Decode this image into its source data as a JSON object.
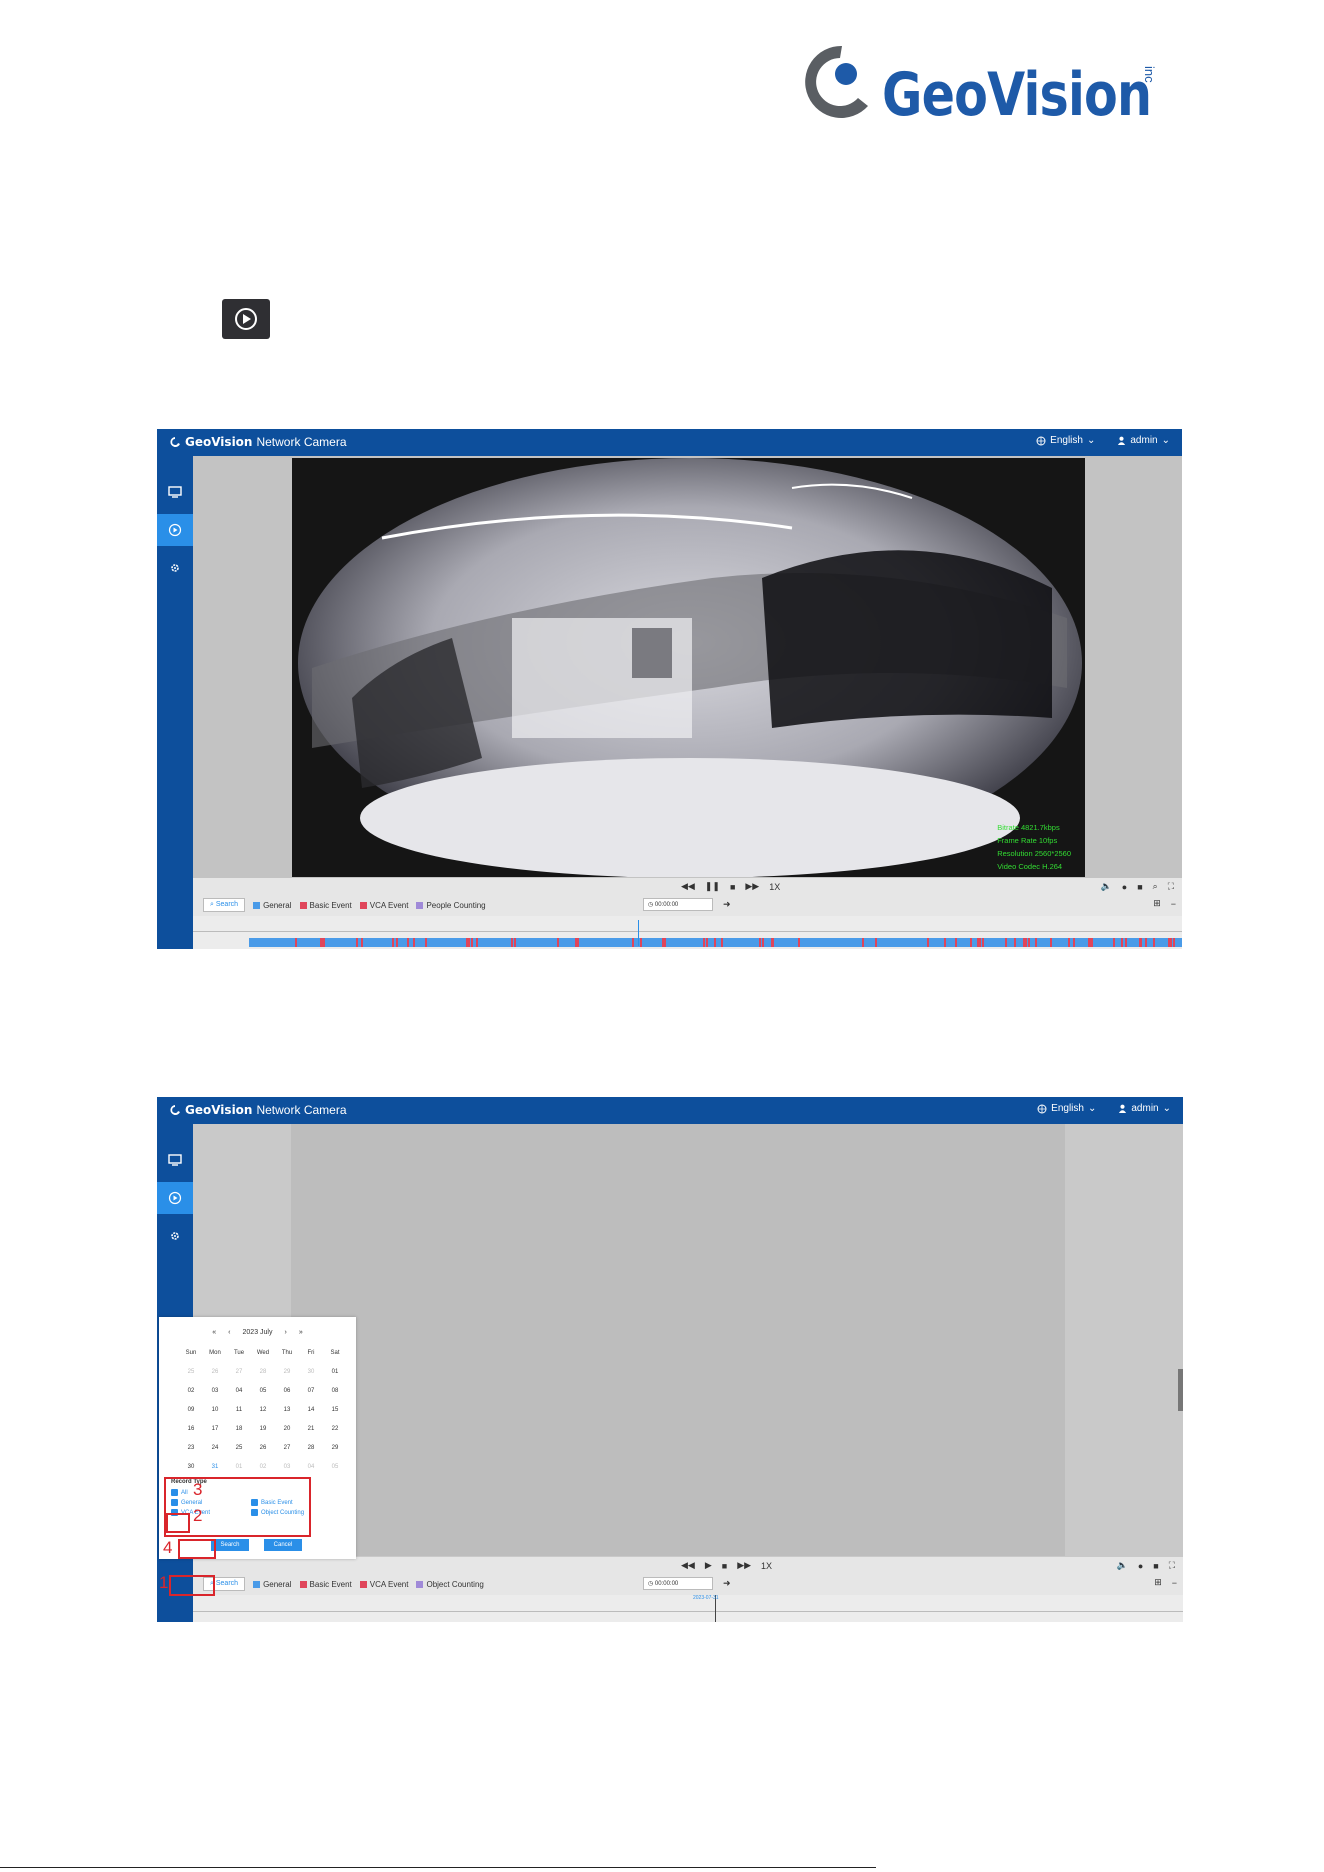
{
  "logo": {
    "word": "GeoVision",
    "inc": "inc"
  },
  "shot1": {
    "app_name": "Network Camera",
    "brand": "GeoVision",
    "language": "English",
    "user": "admin",
    "osd": {
      "bitrate": "Bitrate 4821.7kbps",
      "frame_rate": "Frame Rate 10fps",
      "resolution": "Resolution 2560*2560",
      "codec": "Video Codec H.264"
    },
    "speed": "1X",
    "search_label": "Search",
    "legend": [
      "General",
      "Basic Event",
      "VCA Event",
      "People Counting"
    ],
    "time_value": "00:00:00",
    "colors": {
      "general": "#4a9be8",
      "basic": "#e0455a",
      "vca": "#e0455a",
      "counting": "#a08ad8"
    }
  },
  "shot2": {
    "app_name": "Network Camera",
    "brand": "GeoVision",
    "language": "English",
    "user": "admin",
    "speed": "1X",
    "search_label": "Search",
    "legend": [
      "General",
      "Basic Event",
      "VCA Event",
      "Object Counting"
    ],
    "time_value": "00:00:00",
    "timeline_date": "2023-07-31",
    "calendar": {
      "title": "2023 July",
      "weekdays": [
        "Sun",
        "Mon",
        "Tue",
        "Wed",
        "Thu",
        "Fri",
        "Sat"
      ],
      "weeks": [
        [
          "25",
          "26",
          "27",
          "28",
          "29",
          "30",
          "01"
        ],
        [
          "02",
          "03",
          "04",
          "05",
          "06",
          "07",
          "08"
        ],
        [
          "09",
          "10",
          "11",
          "12",
          "13",
          "14",
          "15"
        ],
        [
          "16",
          "17",
          "18",
          "19",
          "20",
          "21",
          "22"
        ],
        [
          "23",
          "24",
          "25",
          "26",
          "27",
          "28",
          "29"
        ],
        [
          "30",
          "31",
          "01",
          "02",
          "03",
          "04",
          "05"
        ]
      ],
      "selected": "31",
      "record_type_label": "Record Type",
      "options": [
        "All",
        "General",
        "Basic Event",
        "VCA Event",
        "Object Counting"
      ],
      "search_btn": "Search",
      "cancel_btn": "Cancel"
    },
    "steps": [
      "1",
      "2",
      "3",
      "4"
    ]
  }
}
